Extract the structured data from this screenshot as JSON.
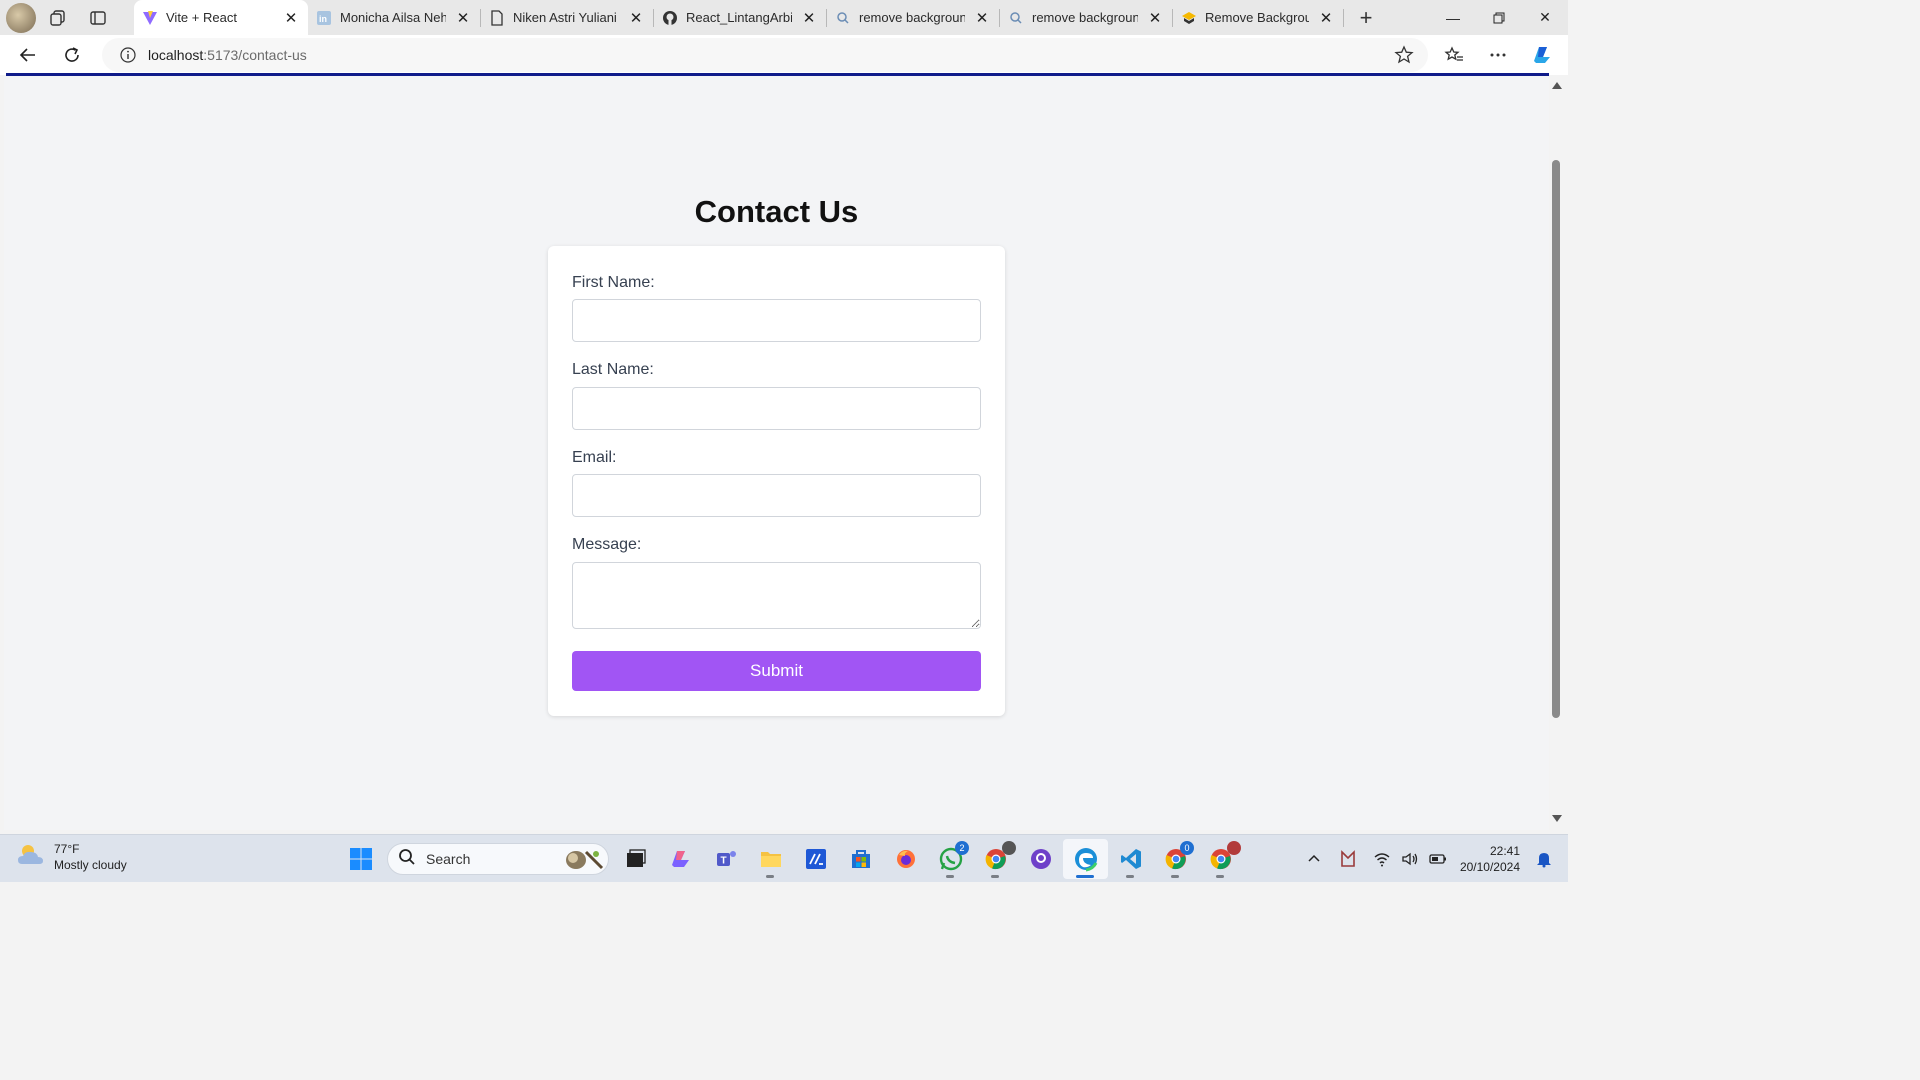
{
  "browser": {
    "tabs": [
      {
        "title": "Vite + React",
        "icon": "vite-icon",
        "active": true
      },
      {
        "title": "Monicha Ailsa Neha",
        "icon": "linkedin-icon",
        "active": false
      },
      {
        "title": "Niken Astri Yuliani -",
        "icon": "document-icon",
        "active": false
      },
      {
        "title": "React_LintangArbiSu",
        "icon": "github-icon",
        "active": false
      },
      {
        "title": "remove background",
        "icon": "search-icon",
        "active": false
      },
      {
        "title": "remove background",
        "icon": "search-icon",
        "active": false
      },
      {
        "title": "Remove Background",
        "icon": "removebg-icon",
        "active": false
      }
    ],
    "url_host": "localhost",
    "url_path": ":5173/contact-us"
  },
  "page": {
    "title": "Contact Us",
    "fields": {
      "first_name": {
        "label": "First Name:",
        "value": ""
      },
      "last_name": {
        "label": "Last Name:",
        "value": ""
      },
      "email": {
        "label": "Email:",
        "value": ""
      },
      "message": {
        "label": "Message:",
        "value": ""
      }
    },
    "submit_label": "Submit",
    "accent_color": "#a155f4"
  },
  "taskbar": {
    "weather_temp": "77°F",
    "weather_desc": "Mostly cloudy",
    "search_label": "Search",
    "badges": {
      "whatsapp": "2",
      "chrome2": "0"
    },
    "time": "22:41",
    "date": "20/10/2024"
  }
}
